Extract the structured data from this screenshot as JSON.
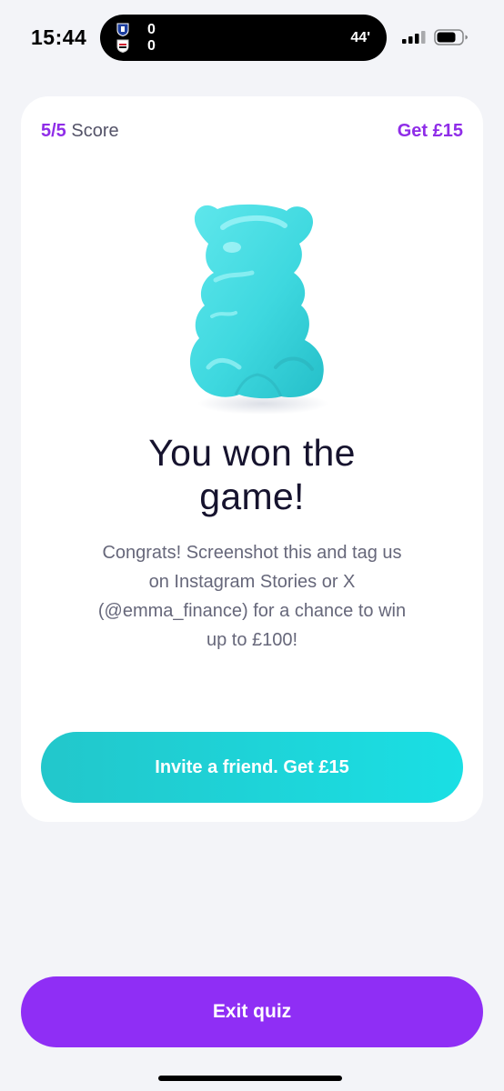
{
  "status_bar": {
    "time": "15:44",
    "match": {
      "home_score": "0",
      "away_score": "0",
      "minute": "44'"
    }
  },
  "card": {
    "score_value": "5/5",
    "score_label": "Score",
    "reward_link": "Get £15",
    "bear_icon": "gummy-bear-icon",
    "headline_line1": "You won the",
    "headline_line2": "game!",
    "message_lines": [
      "Congrats! Screenshot this and tag us",
      "on Instagram Stories or X",
      "(@emma_finance) for a chance to win",
      "up to £100!"
    ],
    "invite_button": "Invite a friend. Get £15"
  },
  "footer": {
    "exit_button": "Exit quiz"
  },
  "colors": {
    "accent_purple": "#8f2ef5",
    "accent_teal": "#1adfe4",
    "bear": "#3ed8df",
    "background": "#f3f4f8"
  }
}
